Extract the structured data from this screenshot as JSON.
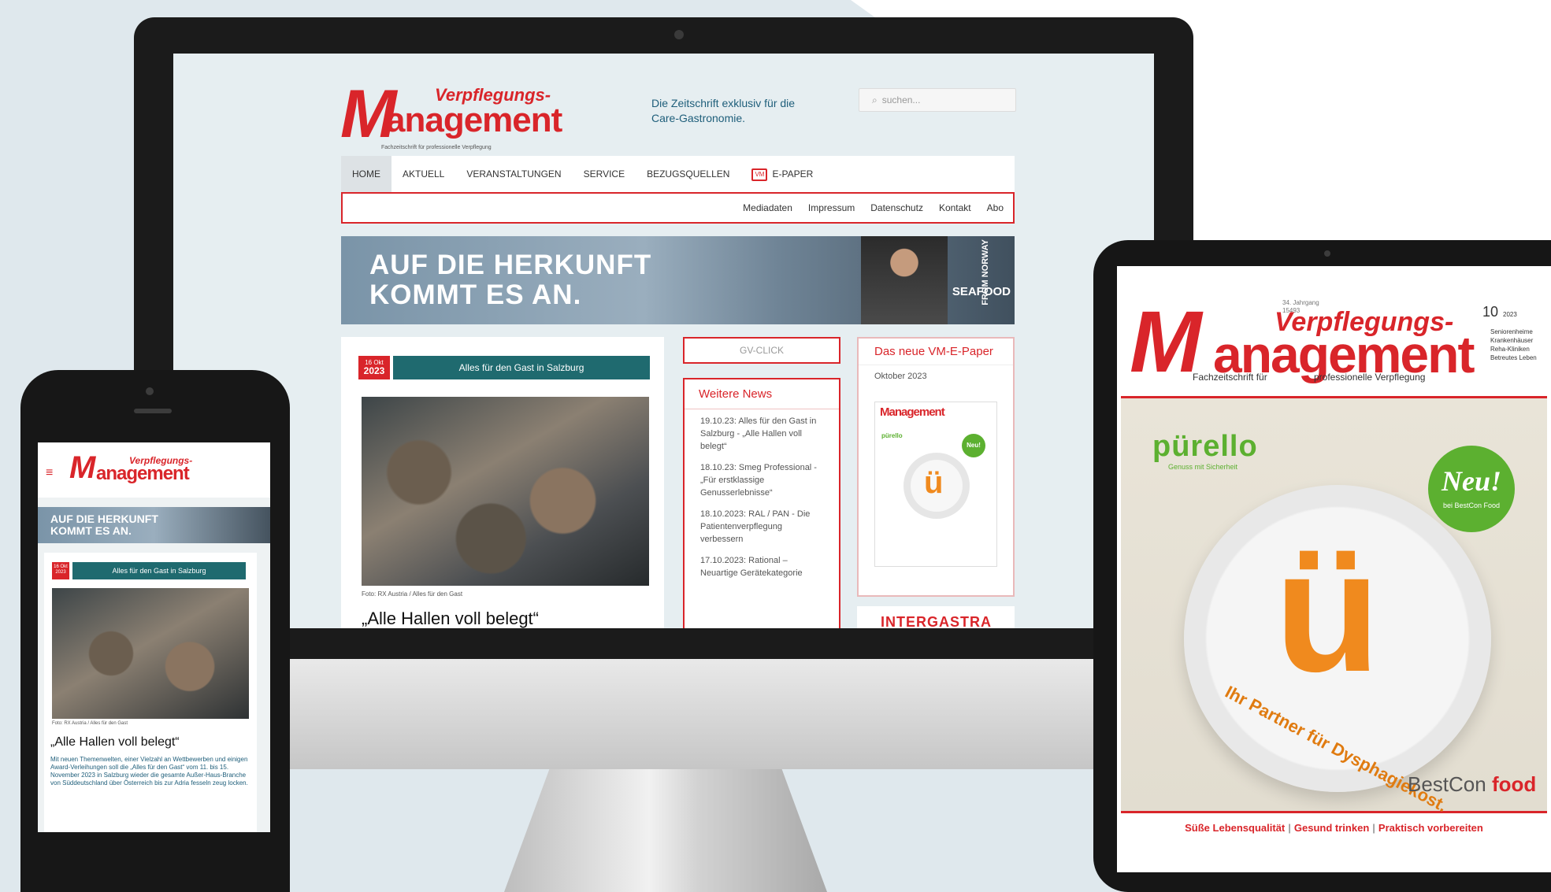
{
  "colors": {
    "brand_red": "#d9252a",
    "teal": "#1f6a6f",
    "puretto_green": "#5cb030",
    "puretto_orange": "#f08a1e"
  },
  "monitor": {
    "logo": {
      "top": "Verpflegungs-",
      "main": "anagement",
      "initial": "M",
      "sub": "Fachzeitschrift für professionelle Verpflegung"
    },
    "tagline": "Die Zeitschrift exklusiv für die Care-Gastronomie.",
    "search_placeholder": "suchen...",
    "nav": [
      "HOME",
      "AKTUELL",
      "VERANSTALTUNGEN",
      "SERVICE",
      "BEZUGSQUELLEN",
      "E-PAPER"
    ],
    "subnav": [
      "Mediadaten",
      "Impressum",
      "Datenschutz",
      "Kontakt",
      "Abo"
    ],
    "banner": {
      "line1": "AUF DIE HERKUNFT",
      "line2": "KOMMT ES AN.",
      "brand": "SEAFOOD",
      "brand_side": "FROM NORWAY"
    },
    "article": {
      "date_day": "16 Okt",
      "date_year": "2023",
      "kicker": "Alles für den Gast in Salzburg",
      "credit": "Foto: RX Austria / Alles für den Gast",
      "title": "„Alle Hallen voll belegt“"
    },
    "gv_click": "GV-CLICK",
    "news": {
      "heading": "Weitere News",
      "items": [
        "19.10.23: Alles für den Gast in Salzburg - „Alle Hallen voll belegt“",
        "18.10.23: Smeg Professional - „Für erstklassige Genusserlebnisse“",
        "18.10.2023: RAL / PAN - Die Patientenverpflegung verbessern",
        "17.10.2023: Rational – Neuartige Gerätekategorie"
      ]
    },
    "epaper": {
      "heading": "Das neue VM-E-Paper",
      "month": "Oktober 2023",
      "mini_brand": "pürello",
      "mini_badge": "Neu!"
    },
    "intergastra": "INTERGASTRA"
  },
  "phone": {
    "logo": {
      "top": "Verpflegungs-",
      "main": "anagement",
      "initial": "M"
    },
    "menu_icon": "≡",
    "banner": {
      "line1": "AUF DIE HERKUNFT",
      "line2": "KOMMT ES AN."
    },
    "article": {
      "date_day": "16 Okt",
      "date_year": "2023",
      "kicker": "Alles für den Gast in Salzburg",
      "credit": "Foto: RX Austria / Alles für den Gast",
      "title": "„Alle Hallen voll belegt“",
      "body": "Mit neuen Themenwelten, einer Vielzahl an Wettbewerben und einigen Award-Verleihungen soll die „Alles für den Gast“ vom 11. bis 15. November 2023 in Salzburg wieder die gesamte Außer-Haus-Branche von Süddeutschland über Österreich bis zur Adria fesseln zeug locken."
    }
  },
  "tablet": {
    "edition_label": "34. Jahrgang\n15493",
    "issue_number": "10",
    "issue_year": "2023",
    "logo": {
      "top": "Verpflegungs-",
      "main": "anagement",
      "initial": "M",
      "sub1": "Fachzeitschrift für",
      "sub2": "professionelle Verpflegung"
    },
    "targets": [
      "Seniorenheime",
      "Krankenhäuser",
      "Reha-Kliniken",
      "Betreutes Leben"
    ],
    "brand": "pürello",
    "brand_sub": "Genuss mit Sicherheit",
    "badge_main": "Neu!",
    "badge_sub": "bei BestCon Food",
    "plate_letter": "ü",
    "plate_text": "Ihr Partner für Dysphagiekost.",
    "bestcon": "BestCon",
    "bestcon_food": "food",
    "footer": [
      "Süße Lebensqualität",
      "Gesund trinken",
      "Praktisch vorbereiten"
    ]
  }
}
